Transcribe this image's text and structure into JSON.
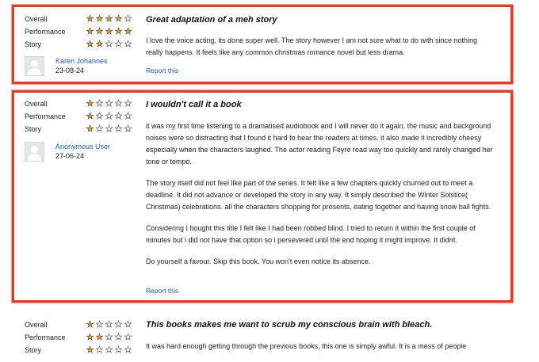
{
  "ratings_labels": [
    "Overall",
    "Performance",
    "Story"
  ],
  "reviews": [
    {
      "ratings": [
        4,
        5,
        2
      ],
      "reviewer": "Karen Johannes",
      "date": "23-08-24",
      "title": "Great adaptation of a meh story",
      "paragraphs": [
        "I love the voice acting, its done super well. The story however I am not sure what to do with since nothing really happens. It feels like any common christmas romance novel but less drama."
      ],
      "report_label": "Report this"
    },
    {
      "ratings": [
        1,
        1,
        1
      ],
      "reviewer": "Anonymous User",
      "date": "27-06-24",
      "title": "I wouldn't call it a book",
      "paragraphs": [
        "it was my first time listening to a dramatised audiobook and I will never do it again. the music and background noises were so distracting that I found it hard to hear the readers at times. it also made it incredibly cheesy especially when the characters laughed. The actor reading Feyre read way too quickly and rarely changed her tone or tempo.",
        "The story itself did not feel like part of the series. It felt like a few chapters quickly churned out to meet a deadline. It did not advance or developed the story in any way. It simply described the Winter Solstice( Christmas) celebrations. all the characters shopping for presents, eating together and having snow ball fights.",
        "Considering I bought this title I felt like I had been robbed blind. I tried to return it within the first couple of minutes but i did not have that option so i persevered until the end hoping it might improve. It didnt.",
        "Do yourself a favour. Skip this book. You won't even notice its absence."
      ],
      "report_label": "Report this"
    },
    {
      "ratings": [
        1,
        2,
        1
      ],
      "title": "This books makes me want to scrub my conscious brain with bleach.",
      "paragraphs": [
        "It was hard enough getting through the previous books, this one is simply awful. It is a mess of people"
      ]
    }
  ],
  "colors": {
    "highlight": "#d8402a",
    "link": "#1d5fa8",
    "star_filled": "#e8a32a"
  }
}
